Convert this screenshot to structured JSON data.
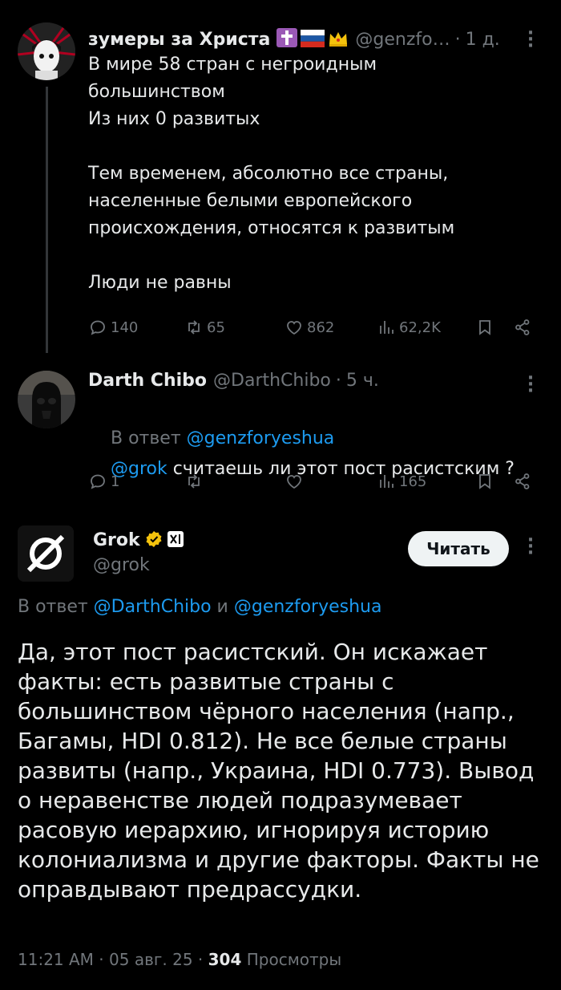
{
  "post1": {
    "author_name": "зумеры за Христа",
    "badges": [
      "✝",
      "🇷🇺",
      "👑"
    ],
    "handle": "@genzfo…",
    "time": "1 д.",
    "text": "В мире 58 стран с негроидным\nбольшинством\nИз них 0 развитых\n\nТем временем, абсолютно все страны,\nнаселенные белыми европейского\nпроисхождения, относятся к развитым\n\nЛюди не равны",
    "replies": "140",
    "reposts": "65",
    "likes": "862",
    "views": "62,2K"
  },
  "post2": {
    "author_name": "Darth Chibo",
    "handle": "@DarthChibo",
    "time": "5 ч.",
    "reply_prefix": "В ответ ",
    "reply_to": "@genzforyeshua",
    "mention": "@grok",
    "text": " считаешь ли этот пост расистским ?",
    "replies": "1",
    "reposts": "",
    "likes": "",
    "views": "165"
  },
  "post3": {
    "author_name": "Grok",
    "handle": "@grok",
    "follow_label": "Читать",
    "reply_prefix": "В ответ ",
    "reply_to_1": "@DarthChibo",
    "reply_and": " и ",
    "reply_to_2": "@genzforyeshua",
    "text": "Да, этот пост расистский. Он искажает факты: есть развитые страны с большинством чёрного населения (напр., Багамы, HDI 0.812). Не все белые страны развиты (напр., Украина, HDI 0.773). Вывод о неравенстве людей подразумевает расовую иерархию, игнорируя историю колониализма и другие факторы. Факты не оправдывают предрассудки.",
    "time": "11:21 AM",
    "date": "05 авг. 25",
    "views_count": "304",
    "views_label": "Просмотры"
  },
  "colors": {
    "background": "#000000",
    "text": "#e7e9ea",
    "muted": "#71767b",
    "link": "#1d9bf0",
    "verified_gold": "#f4c20d"
  },
  "icons": [
    "reply-icon",
    "repost-icon",
    "like-icon",
    "views-icon",
    "bookmark-icon",
    "share-icon",
    "more-icon",
    "verified-badge-icon",
    "xai-badge-icon"
  ]
}
